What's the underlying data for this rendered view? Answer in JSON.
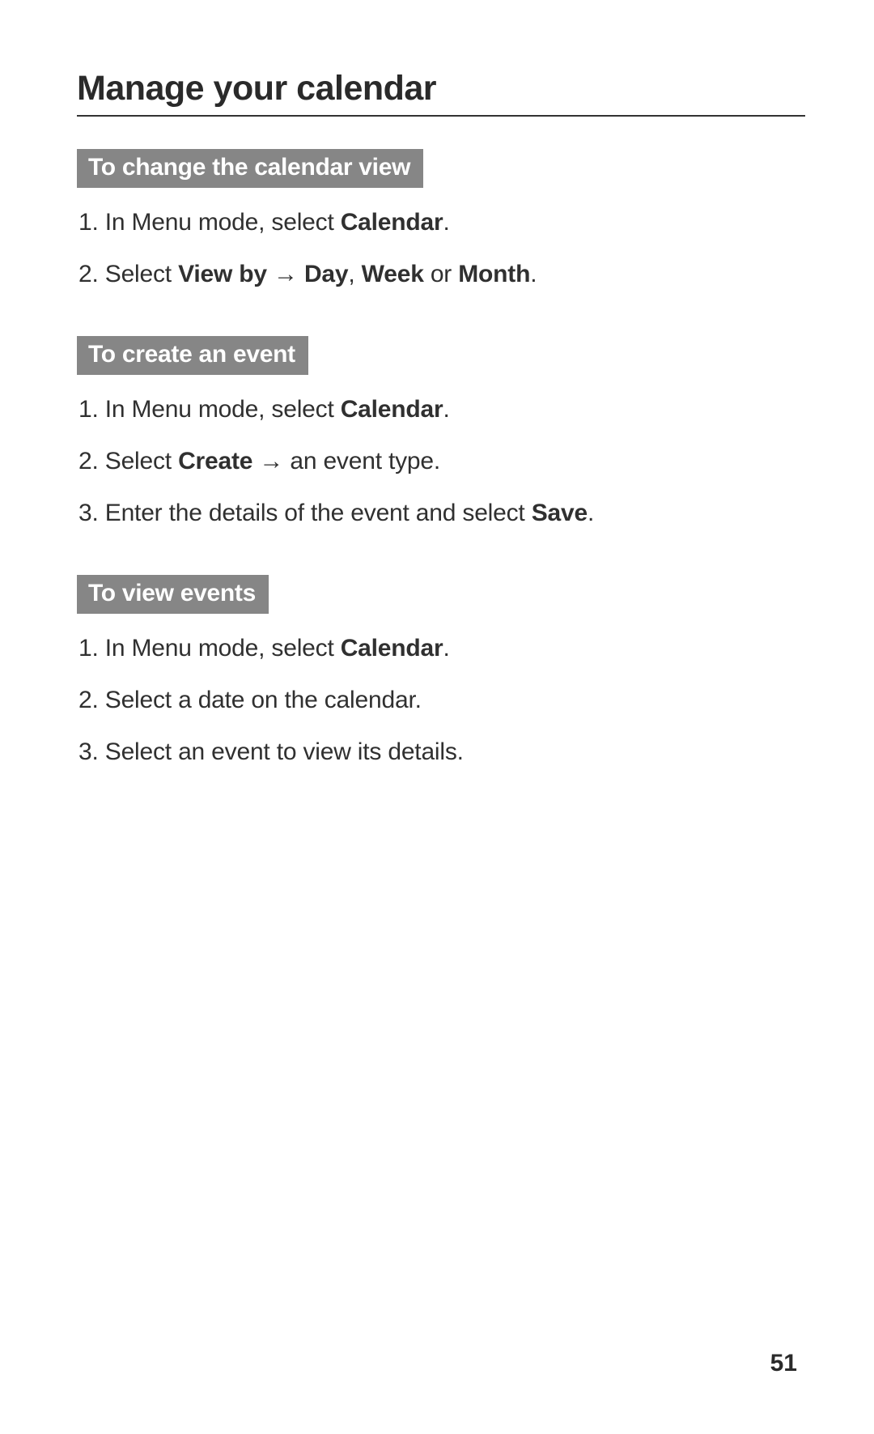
{
  "title": "Manage your calendar",
  "sections": [
    {
      "header": "To change the calendar view",
      "steps": [
        {
          "num": "1.",
          "runs": [
            {
              "t": " In Menu mode, select ",
              "b": false
            },
            {
              "t": "Calendar",
              "b": true
            },
            {
              "t": ".",
              "b": false
            }
          ]
        },
        {
          "num": "2.",
          "runs": [
            {
              "t": " Select ",
              "b": false
            },
            {
              "t": "View by",
              "b": true
            },
            {
              "t": " → ",
              "b": false
            },
            {
              "t": "Day",
              "b": true
            },
            {
              "t": ", ",
              "b": false
            },
            {
              "t": "Week",
              "b": true
            },
            {
              "t": " or ",
              "b": false
            },
            {
              "t": "Month",
              "b": true
            },
            {
              "t": ".",
              "b": false
            }
          ]
        }
      ]
    },
    {
      "header": "To create an event",
      "steps": [
        {
          "num": "1.",
          "runs": [
            {
              "t": " In Menu mode, select ",
              "b": false
            },
            {
              "t": "Calendar",
              "b": true
            },
            {
              "t": ".",
              "b": false
            }
          ]
        },
        {
          "num": "2.",
          "runs": [
            {
              "t": " Select ",
              "b": false
            },
            {
              "t": "Create",
              "b": true
            },
            {
              "t": " → an event type.",
              "b": false
            }
          ]
        },
        {
          "num": "3.",
          "runs": [
            {
              "t": " Enter the details of the event and select ",
              "b": false
            },
            {
              "t": "Save",
              "b": true
            },
            {
              "t": ".",
              "b": false
            }
          ]
        }
      ]
    },
    {
      "header": "To view events",
      "steps": [
        {
          "num": "1.",
          "runs": [
            {
              "t": " In Menu mode, select ",
              "b": false
            },
            {
              "t": "Calendar",
              "b": true
            },
            {
              "t": ".",
              "b": false
            }
          ]
        },
        {
          "num": "2.",
          "runs": [
            {
              "t": " Select a date on the calendar.",
              "b": false
            }
          ]
        },
        {
          "num": "3.",
          "runs": [
            {
              "t": " Select an event to view its details.",
              "b": false
            }
          ]
        }
      ]
    }
  ],
  "page_number": "51"
}
